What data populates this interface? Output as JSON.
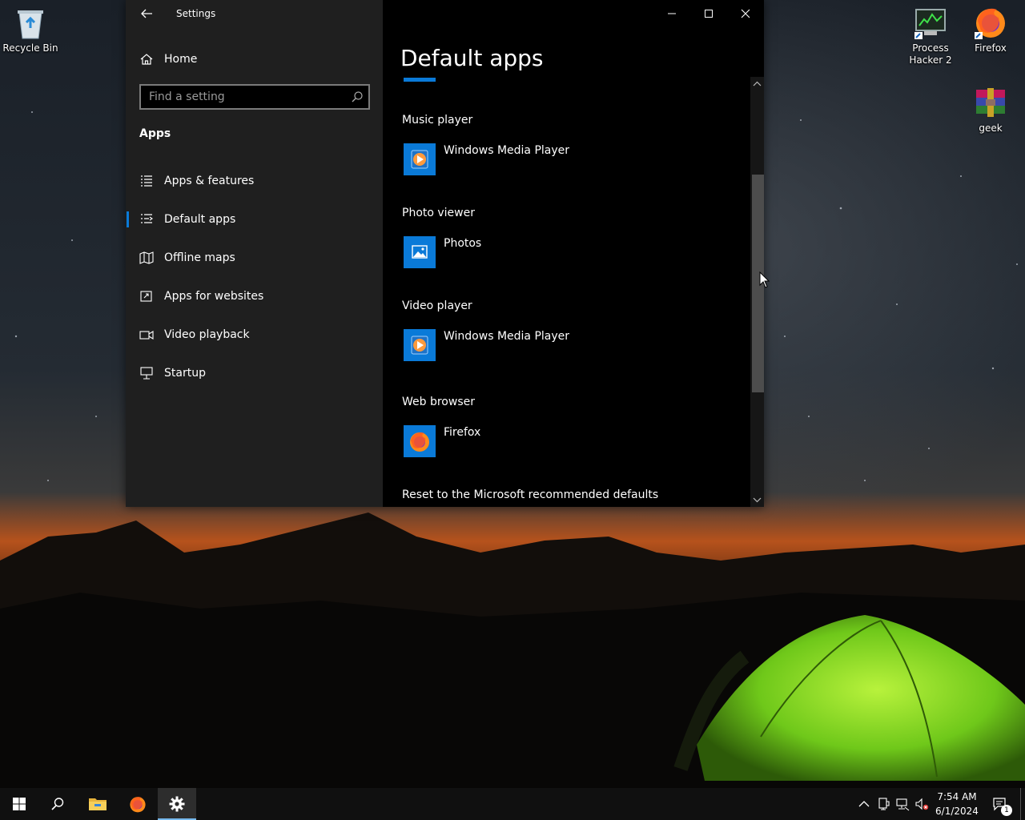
{
  "desktop": {
    "icons": [
      {
        "label": "Recycle Bin",
        "icon": "recycle-bin-icon"
      },
      {
        "label": "Process Hacker 2",
        "icon": "process-hacker-icon"
      },
      {
        "label": "Firefox",
        "icon": "firefox-icon"
      },
      {
        "label": "geek",
        "icon": "winrar-archive-icon"
      }
    ]
  },
  "settings": {
    "window_title": "Settings",
    "home_label": "Home",
    "search_placeholder": "Find a setting",
    "section_label": "Apps",
    "nav_items": [
      {
        "label": "Apps & features",
        "icon": "list-icon"
      },
      {
        "label": "Default apps",
        "icon": "default-apps-icon",
        "selected": true
      },
      {
        "label": "Offline maps",
        "icon": "map-icon"
      },
      {
        "label": "Apps for websites",
        "icon": "open-in-new-icon"
      },
      {
        "label": "Video playback",
        "icon": "video-camera-icon"
      },
      {
        "label": "Startup",
        "icon": "monitor-stand-icon"
      }
    ],
    "page_title": "Default apps",
    "categories": [
      {
        "label": "Music player",
        "app": "Windows Media Player",
        "icon": "windows-media-player-icon"
      },
      {
        "label": "Photo viewer",
        "app": "Photos",
        "icon": "photos-icon"
      },
      {
        "label": "Video player",
        "app": "Windows Media Player",
        "icon": "windows-media-player-icon"
      },
      {
        "label": "Web browser",
        "app": "Firefox",
        "icon": "firefox-icon"
      }
    ],
    "reset_label": "Reset to the Microsoft recommended defaults",
    "accent_color": "#0a7ad8"
  },
  "taskbar": {
    "pinned": [
      {
        "name": "start",
        "icon": "windows-logo-icon"
      },
      {
        "name": "search",
        "icon": "search-icon"
      },
      {
        "name": "file-explorer",
        "icon": "folder-icon"
      },
      {
        "name": "firefox",
        "icon": "firefox-icon"
      },
      {
        "name": "settings",
        "icon": "gear-icon",
        "active": true
      }
    ],
    "clock_time": "7:54 AM",
    "clock_date": "6/1/2024",
    "notification_count": "1"
  }
}
